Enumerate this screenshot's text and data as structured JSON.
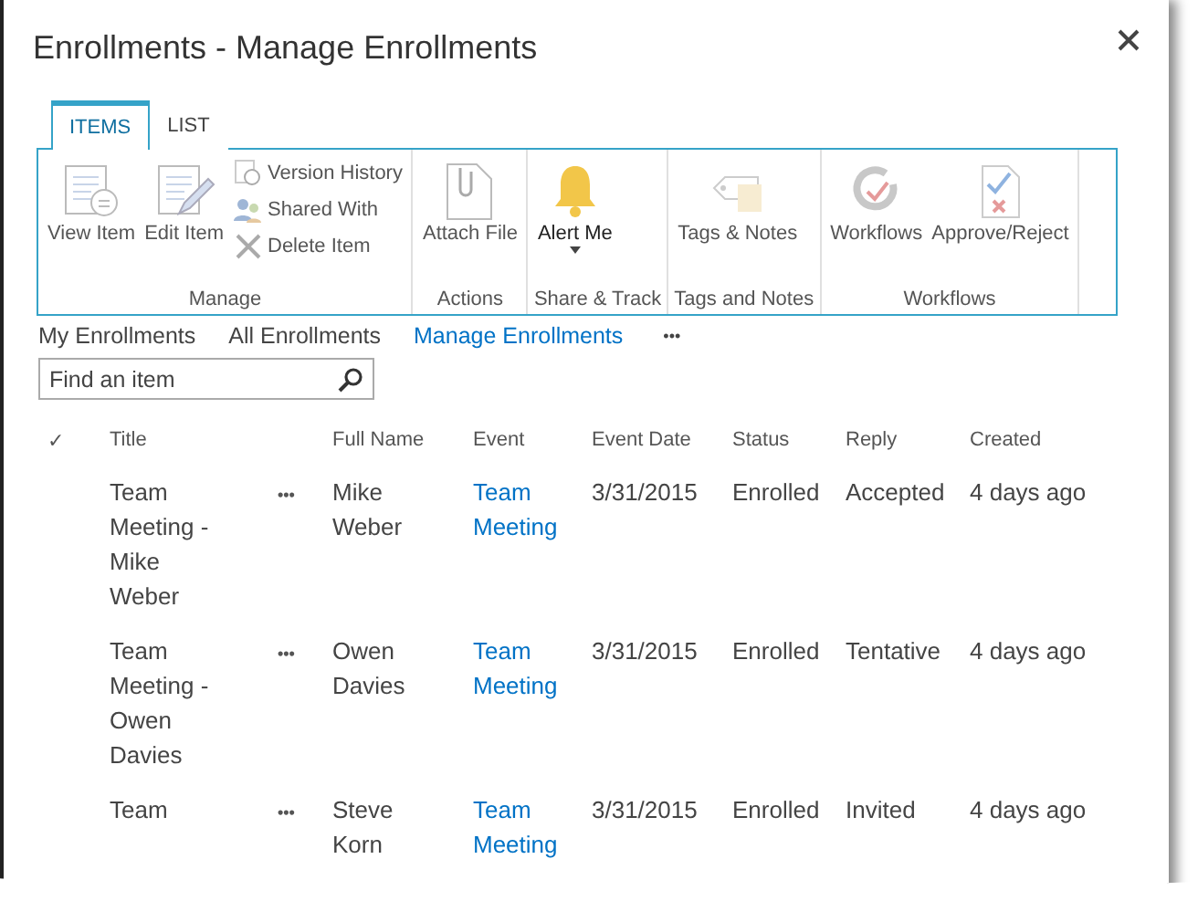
{
  "window": {
    "title": "Enrollments - Manage Enrollments"
  },
  "tabs": [
    {
      "label": "ITEMS",
      "selected": true
    },
    {
      "label": "LIST",
      "selected": false
    }
  ],
  "ribbon": {
    "groups": [
      {
        "label": "Manage",
        "buttons": [
          {
            "kind": "large",
            "label": "View Item",
            "disabled": true
          },
          {
            "kind": "large",
            "label": "Edit Item",
            "disabled": true
          },
          {
            "kind": "small",
            "label": "Version History",
            "disabled": true
          },
          {
            "kind": "small",
            "label": "Shared With",
            "disabled": true
          },
          {
            "kind": "small",
            "label": "Delete Item",
            "disabled": true
          }
        ]
      },
      {
        "label": "Actions",
        "buttons": [
          {
            "kind": "large",
            "label": "Attach File",
            "disabled": true
          }
        ]
      },
      {
        "label": "Share & Track",
        "buttons": [
          {
            "kind": "large",
            "label": "Alert Me",
            "dropdown": true,
            "disabled": false
          }
        ]
      },
      {
        "label": "Tags and Notes",
        "buttons": [
          {
            "kind": "large",
            "label": "Tags & Notes",
            "disabled": true
          }
        ]
      },
      {
        "label": "Workflows",
        "buttons": [
          {
            "kind": "large",
            "label": "Workflows",
            "disabled": true
          },
          {
            "kind": "large",
            "label": "Approve/Reject",
            "disabled": true
          }
        ]
      }
    ]
  },
  "views": [
    {
      "label": "My Enrollments",
      "selected": false
    },
    {
      "label": "All Enrollments",
      "selected": false
    },
    {
      "label": "Manage Enrollments",
      "selected": true
    }
  ],
  "views_more": "•••",
  "search": {
    "placeholder": "Find an item"
  },
  "table": {
    "check_header": "✓",
    "columns": [
      "Title",
      "Full Name",
      "Event",
      "Event Date",
      "Status",
      "Reply",
      "Created"
    ],
    "rows": [
      {
        "title": "Team Meeting - Mike Weber",
        "full_name": "Mike Weber",
        "event": "Team Meeting",
        "event_date": "3/31/2015",
        "status": "Enrolled",
        "reply": "Accepted",
        "created": "4 days ago"
      },
      {
        "title": "Team Meeting - Owen Davies",
        "full_name": "Owen Davies",
        "event": "Team Meeting",
        "event_date": "3/31/2015",
        "status": "Enrolled",
        "reply": "Tentative",
        "created": "4 days ago"
      },
      {
        "title": "Team",
        "full_name": "Steve Korn",
        "event": "Team Meeting",
        "event_date": "3/31/2015",
        "status": "Enrolled",
        "reply": "Invited",
        "created": "4 days ago"
      }
    ]
  },
  "row_menu": "•••"
}
